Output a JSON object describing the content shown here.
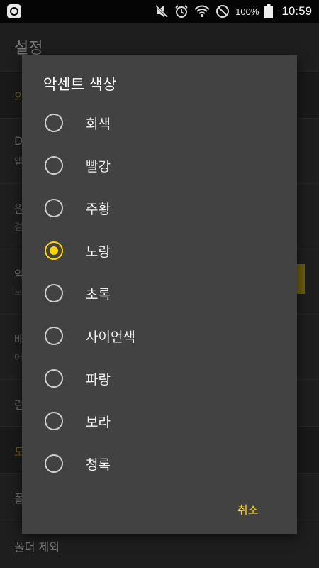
{
  "status_bar": {
    "battery_percent": "100%",
    "time": "10:59"
  },
  "background": {
    "title": "설정",
    "rows": [
      {
        "label": "외"
      },
      {
        "label": "D",
        "sub": "앨"
      },
      {
        "label": "원",
        "sub": "검"
      },
      {
        "label": "악",
        "sub": "노"
      },
      {
        "label": "배",
        "sub": "어"
      },
      {
        "label": "런"
      },
      {
        "label": "도"
      },
      {
        "label": "폴"
      }
    ],
    "bottom_item": "폴더 제외"
  },
  "dialog": {
    "title": "악센트 색상",
    "options": [
      {
        "label": "회색",
        "checked": false
      },
      {
        "label": "빨강",
        "checked": false
      },
      {
        "label": "주황",
        "checked": false
      },
      {
        "label": "노랑",
        "checked": true
      },
      {
        "label": "초록",
        "checked": false
      },
      {
        "label": "사이언색",
        "checked": false
      },
      {
        "label": "파랑",
        "checked": false
      },
      {
        "label": "보라",
        "checked": false
      },
      {
        "label": "청록",
        "checked": false
      }
    ],
    "cancel_label": "취소",
    "accent_color": "#ffd600"
  }
}
